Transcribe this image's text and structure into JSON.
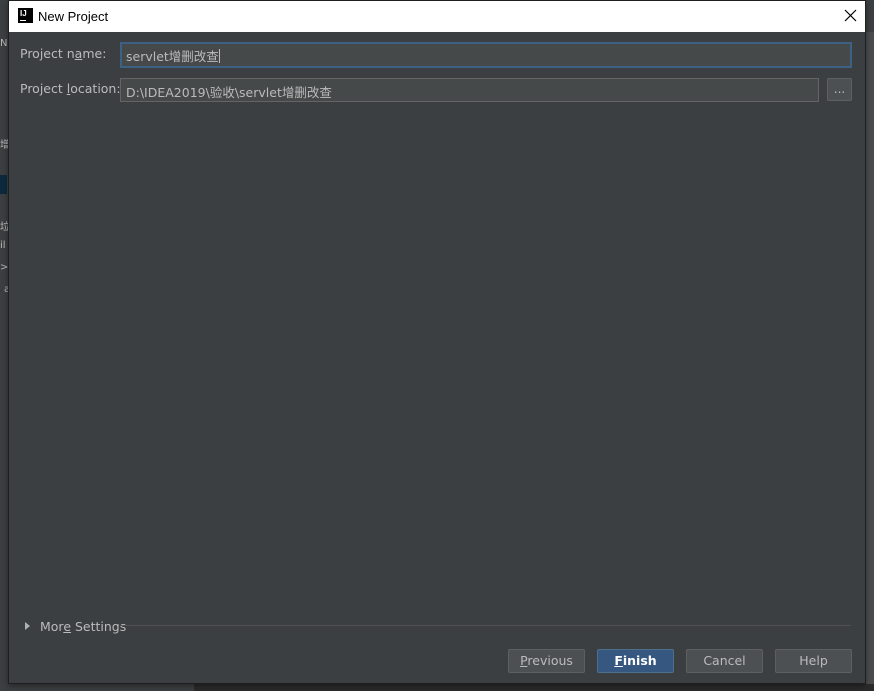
{
  "dialog": {
    "title": "New Project"
  },
  "form": {
    "project_name": {
      "label_before": "Project n",
      "label_mnemonic": "a",
      "label_after": "me:",
      "value": "servlet增删改查"
    },
    "project_location": {
      "label_before": "Project ",
      "label_mnemonic": "l",
      "label_after": "ocation:",
      "value": "D:\\IDEA2019\\验收\\servlet增删改查",
      "browse_label": "..."
    }
  },
  "more_settings": {
    "label_before": "Mor",
    "label_mnemonic": "e",
    "label_after": " Settings"
  },
  "buttons": {
    "previous": {
      "mnemonic": "P",
      "rest": "revious"
    },
    "finish": {
      "mnemonic": "F",
      "rest": "inish"
    },
    "cancel": {
      "label": "Cancel"
    },
    "help": {
      "label": "Help"
    }
  },
  "background_fragments": [
    "N",
    "增",
    "垃",
    "il",
    ">",
    "a"
  ],
  "colors": {
    "dialog_bg": "#3c3f41",
    "field_bg": "#45494a",
    "focus_border": "#3d6185",
    "default_button": "#365880",
    "text": "#bbbbbb"
  }
}
